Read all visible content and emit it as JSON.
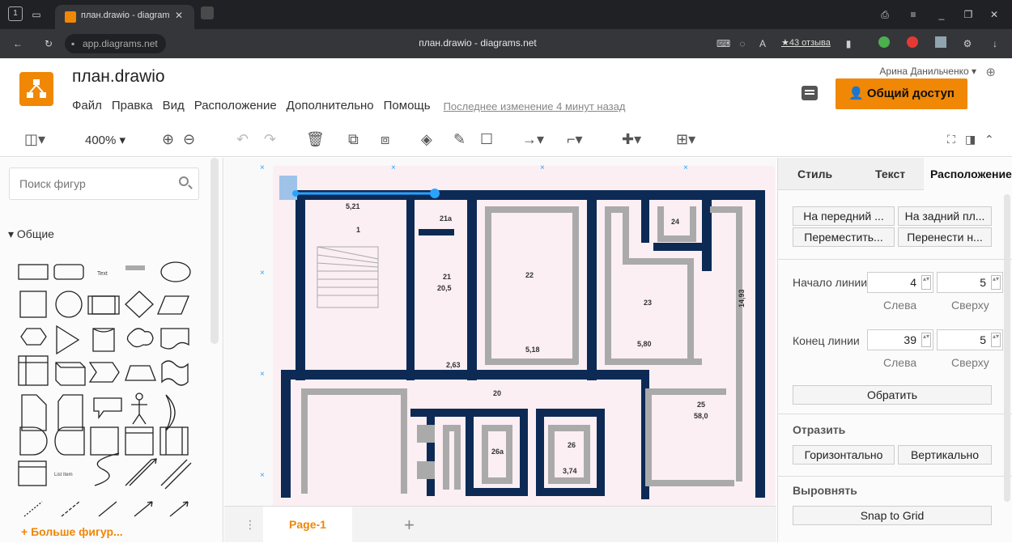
{
  "browser": {
    "tab_count": "1",
    "tab_title": "план.drawio - diagram",
    "url": "app.diagrams.net",
    "page_title": "план.drawio - diagrams.net",
    "reviews": "★43 отзыва"
  },
  "header": {
    "title": "план.drawio",
    "menu": [
      "Файл",
      "Правка",
      "Вид",
      "Расположение",
      "Дополнительно",
      "Помощь"
    ],
    "last_change": "Последнее изменение 4 минут назад",
    "user": "Арина Данильченко",
    "share": "Общий доступ"
  },
  "toolbar": {
    "zoom": "400%"
  },
  "left": {
    "search_placeholder": "Поиск фигур",
    "section": "Общие",
    "shape_text": "Text",
    "shape_list": "List Item",
    "more": "+ Больше фигур..."
  },
  "canvas": {
    "rooms": {
      "r1": "1",
      "r1_area": "5,21",
      "r21a": "21а",
      "r21": "21",
      "r21_area": "20,5",
      "r22": "22",
      "r22_area": "5,18",
      "r23": "23",
      "r23_area": "5,80",
      "r24": "24",
      "r25": "25",
      "r25_area": "58,0",
      "r26": "26",
      "r26_area": "3,74",
      "r26a": "26а",
      "r20": "20",
      "h_2_63": "2,63",
      "side_dim": "14,93"
    }
  },
  "pages": {
    "current": "Page-1"
  },
  "right": {
    "tabs": [
      "Стиль",
      "Текст",
      "Расположение"
    ],
    "to_front": "На передний ...",
    "to_back": "На задний пл...",
    "move": "Переместить...",
    "move2": "Перенести н...",
    "line_start": "Начало линии",
    "line_end": "Конец линии",
    "start_left": "4",
    "start_top": "5",
    "end_left": "39",
    "end_top": "5",
    "left_lbl": "Слева",
    "top_lbl": "Сверху",
    "reverse": "Обратить",
    "mirror": "Отразить",
    "horizontal": "Горизонтально",
    "vertical": "Вертикально",
    "align": "Выровнять",
    "snap": "Snap to Grid"
  },
  "colors": {
    "accent": "#f08705",
    "wall": "#0d2a55"
  }
}
